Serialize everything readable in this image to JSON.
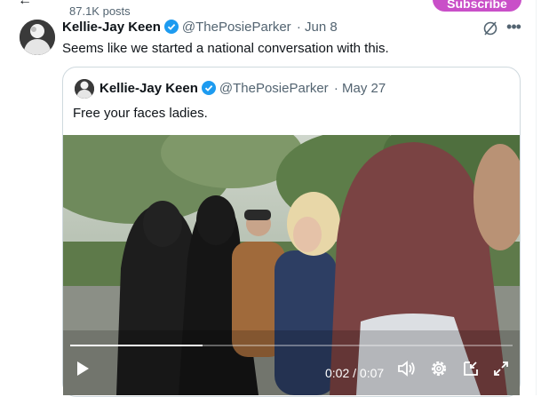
{
  "header": {
    "post_count": "87.1K posts",
    "subscribe_label": "Subscribe"
  },
  "tweet": {
    "name": "Kellie-Jay Keen",
    "handle": "@ThePosieParker",
    "separator": "·",
    "date": "Jun 8",
    "text": "Seems like we started a national conversation with this."
  },
  "quote": {
    "name": "Kellie-Jay Keen",
    "handle": "@ThePosieParker",
    "separator": "·",
    "date": "May 27",
    "text": "Free your faces ladies.",
    "video": {
      "current_time": "0:02",
      "time_separator": "/",
      "duration": "0:07",
      "progress": 0.3
    }
  },
  "icons": {
    "verified": "verified-badge-icon",
    "grok": "grok-icon",
    "more": "more-icon",
    "play": "play-icon",
    "volume": "volume-icon",
    "settings": "gear-icon",
    "pip": "picture-in-picture-icon",
    "fullscreen": "fullscreen-icon"
  },
  "colors": {
    "accent": "#1d9bf0",
    "subscribe": "#c94fc8",
    "muted_text": "#536471"
  }
}
